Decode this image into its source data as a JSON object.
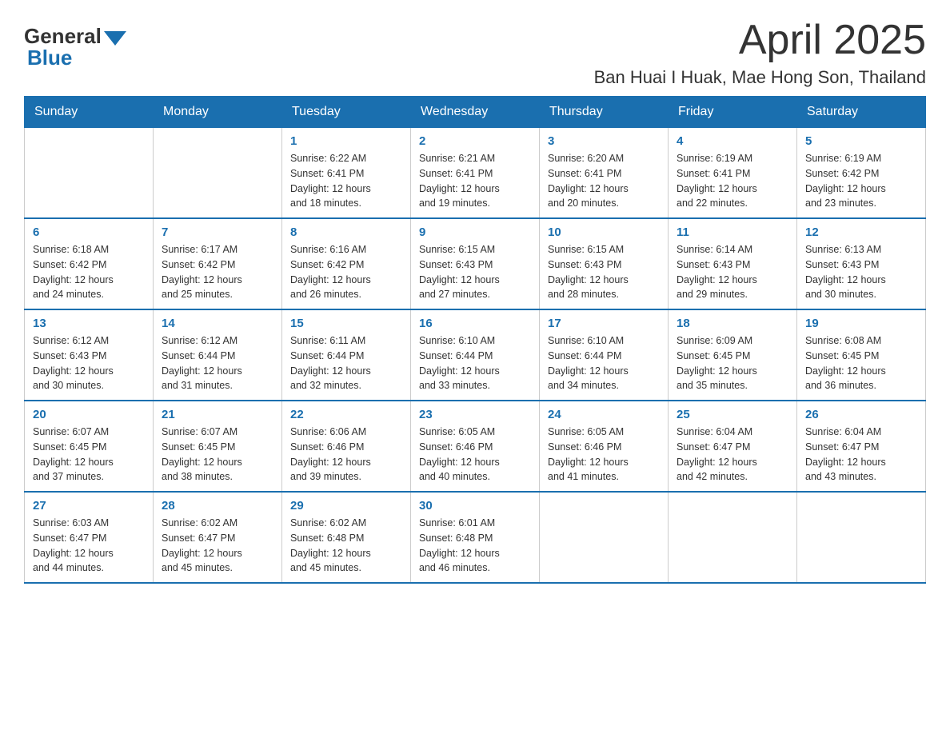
{
  "logo": {
    "general": "General",
    "blue": "Blue"
  },
  "header": {
    "month": "April 2025",
    "location": "Ban Huai I Huak, Mae Hong Son, Thailand"
  },
  "weekdays": [
    "Sunday",
    "Monday",
    "Tuesday",
    "Wednesday",
    "Thursday",
    "Friday",
    "Saturday"
  ],
  "weeks": [
    [
      {
        "day": "",
        "info": ""
      },
      {
        "day": "",
        "info": ""
      },
      {
        "day": "1",
        "info": "Sunrise: 6:22 AM\nSunset: 6:41 PM\nDaylight: 12 hours\nand 18 minutes."
      },
      {
        "day": "2",
        "info": "Sunrise: 6:21 AM\nSunset: 6:41 PM\nDaylight: 12 hours\nand 19 minutes."
      },
      {
        "day": "3",
        "info": "Sunrise: 6:20 AM\nSunset: 6:41 PM\nDaylight: 12 hours\nand 20 minutes."
      },
      {
        "day": "4",
        "info": "Sunrise: 6:19 AM\nSunset: 6:41 PM\nDaylight: 12 hours\nand 22 minutes."
      },
      {
        "day": "5",
        "info": "Sunrise: 6:19 AM\nSunset: 6:42 PM\nDaylight: 12 hours\nand 23 minutes."
      }
    ],
    [
      {
        "day": "6",
        "info": "Sunrise: 6:18 AM\nSunset: 6:42 PM\nDaylight: 12 hours\nand 24 minutes."
      },
      {
        "day": "7",
        "info": "Sunrise: 6:17 AM\nSunset: 6:42 PM\nDaylight: 12 hours\nand 25 minutes."
      },
      {
        "day": "8",
        "info": "Sunrise: 6:16 AM\nSunset: 6:42 PM\nDaylight: 12 hours\nand 26 minutes."
      },
      {
        "day": "9",
        "info": "Sunrise: 6:15 AM\nSunset: 6:43 PM\nDaylight: 12 hours\nand 27 minutes."
      },
      {
        "day": "10",
        "info": "Sunrise: 6:15 AM\nSunset: 6:43 PM\nDaylight: 12 hours\nand 28 minutes."
      },
      {
        "day": "11",
        "info": "Sunrise: 6:14 AM\nSunset: 6:43 PM\nDaylight: 12 hours\nand 29 minutes."
      },
      {
        "day": "12",
        "info": "Sunrise: 6:13 AM\nSunset: 6:43 PM\nDaylight: 12 hours\nand 30 minutes."
      }
    ],
    [
      {
        "day": "13",
        "info": "Sunrise: 6:12 AM\nSunset: 6:43 PM\nDaylight: 12 hours\nand 30 minutes."
      },
      {
        "day": "14",
        "info": "Sunrise: 6:12 AM\nSunset: 6:44 PM\nDaylight: 12 hours\nand 31 minutes."
      },
      {
        "day": "15",
        "info": "Sunrise: 6:11 AM\nSunset: 6:44 PM\nDaylight: 12 hours\nand 32 minutes."
      },
      {
        "day": "16",
        "info": "Sunrise: 6:10 AM\nSunset: 6:44 PM\nDaylight: 12 hours\nand 33 minutes."
      },
      {
        "day": "17",
        "info": "Sunrise: 6:10 AM\nSunset: 6:44 PM\nDaylight: 12 hours\nand 34 minutes."
      },
      {
        "day": "18",
        "info": "Sunrise: 6:09 AM\nSunset: 6:45 PM\nDaylight: 12 hours\nand 35 minutes."
      },
      {
        "day": "19",
        "info": "Sunrise: 6:08 AM\nSunset: 6:45 PM\nDaylight: 12 hours\nand 36 minutes."
      }
    ],
    [
      {
        "day": "20",
        "info": "Sunrise: 6:07 AM\nSunset: 6:45 PM\nDaylight: 12 hours\nand 37 minutes."
      },
      {
        "day": "21",
        "info": "Sunrise: 6:07 AM\nSunset: 6:45 PM\nDaylight: 12 hours\nand 38 minutes."
      },
      {
        "day": "22",
        "info": "Sunrise: 6:06 AM\nSunset: 6:46 PM\nDaylight: 12 hours\nand 39 minutes."
      },
      {
        "day": "23",
        "info": "Sunrise: 6:05 AM\nSunset: 6:46 PM\nDaylight: 12 hours\nand 40 minutes."
      },
      {
        "day": "24",
        "info": "Sunrise: 6:05 AM\nSunset: 6:46 PM\nDaylight: 12 hours\nand 41 minutes."
      },
      {
        "day": "25",
        "info": "Sunrise: 6:04 AM\nSunset: 6:47 PM\nDaylight: 12 hours\nand 42 minutes."
      },
      {
        "day": "26",
        "info": "Sunrise: 6:04 AM\nSunset: 6:47 PM\nDaylight: 12 hours\nand 43 minutes."
      }
    ],
    [
      {
        "day": "27",
        "info": "Sunrise: 6:03 AM\nSunset: 6:47 PM\nDaylight: 12 hours\nand 44 minutes."
      },
      {
        "day": "28",
        "info": "Sunrise: 6:02 AM\nSunset: 6:47 PM\nDaylight: 12 hours\nand 45 minutes."
      },
      {
        "day": "29",
        "info": "Sunrise: 6:02 AM\nSunset: 6:48 PM\nDaylight: 12 hours\nand 45 minutes."
      },
      {
        "day": "30",
        "info": "Sunrise: 6:01 AM\nSunset: 6:48 PM\nDaylight: 12 hours\nand 46 minutes."
      },
      {
        "day": "",
        "info": ""
      },
      {
        "day": "",
        "info": ""
      },
      {
        "day": "",
        "info": ""
      }
    ]
  ],
  "colors": {
    "header_bg": "#1a6faf",
    "header_text": "#ffffff",
    "day_number": "#1a6faf",
    "border": "#cccccc"
  }
}
